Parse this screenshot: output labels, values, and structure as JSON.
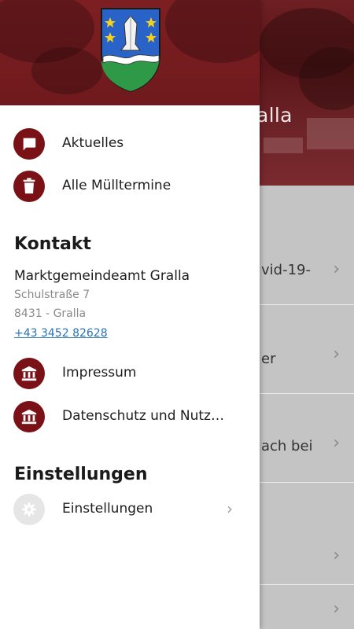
{
  "background": {
    "header_title": "alla",
    "rows": [
      {
        "text": "vid-19-"
      },
      {
        "text": "er"
      },
      {
        "text": "ach bei"
      },
      {
        "text": ""
      },
      {
        "text": ""
      }
    ]
  },
  "drawer": {
    "nav": [
      {
        "label": "Aktuelles",
        "icon": "chat-icon"
      },
      {
        "label": "Alle Mülltermine",
        "icon": "trash-icon"
      }
    ],
    "contact": {
      "title": "Kontakt",
      "name": "Marktgemeindeamt Gralla",
      "street": "Schulstraße 7",
      "city": "8431 - Gralla",
      "phone": "+43 3452 82628"
    },
    "legal": [
      {
        "label": "Impressum",
        "icon": "building-icon"
      },
      {
        "label": "Datenschutz und Nutz…",
        "icon": "building-icon"
      }
    ],
    "settings": {
      "title": "Einstellungen",
      "item_label": "Einstellungen",
      "icon": "gear-icon"
    }
  },
  "colors": {
    "brand": "#7a1116",
    "link": "#2a73b8"
  }
}
